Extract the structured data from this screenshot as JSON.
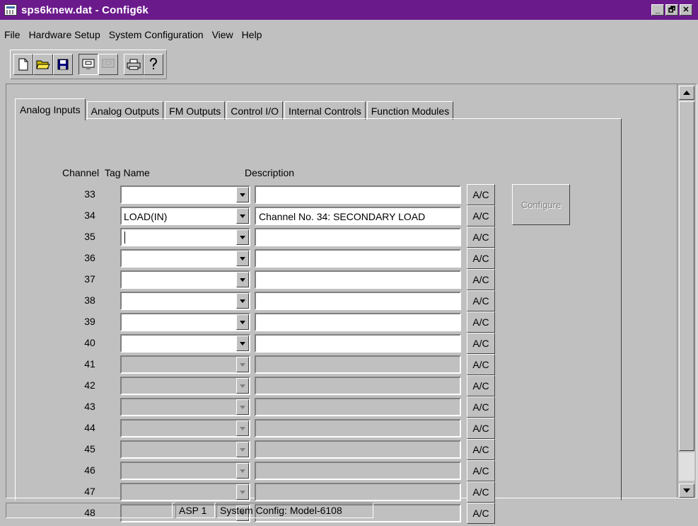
{
  "window": {
    "title": "sps6knew.dat - Config6k",
    "controls": [
      "_",
      "🗗",
      "✕"
    ]
  },
  "menu": [
    "File",
    "Hardware Setup",
    "System Configuration",
    "View",
    "Help"
  ],
  "toolbar": {
    "buttons": [
      "new-file-icon",
      "open-folder-icon",
      "save-disk-icon",
      "monitor-icon",
      "disabled-monitor-icon",
      "print-icon",
      "help-question-icon"
    ]
  },
  "tabs": [
    "Analog Inputs",
    "Analog Outputs",
    "FM Outputs",
    "Control I/O",
    "Internal Controls",
    "Function Modules"
  ],
  "active_tab": "Analog Inputs",
  "columns": {
    "channel": "Channel",
    "tag": "Tag Name",
    "description": "Description"
  },
  "rows": [
    {
      "channel": "33",
      "tag": "",
      "description": "",
      "ac": "A/C",
      "enabled": true
    },
    {
      "channel": "34",
      "tag": "LOAD(IN)",
      "description": "Channel No. 34: SECONDARY LOAD",
      "ac": "A/C",
      "enabled": true
    },
    {
      "channel": "35",
      "tag": "",
      "description": "",
      "ac": "A/C",
      "enabled": true
    },
    {
      "channel": "36",
      "tag": "",
      "description": "",
      "ac": "A/C",
      "enabled": true
    },
    {
      "channel": "37",
      "tag": "",
      "description": "",
      "ac": "A/C",
      "enabled": true
    },
    {
      "channel": "38",
      "tag": "",
      "description": "",
      "ac": "A/C",
      "enabled": true
    },
    {
      "channel": "39",
      "tag": "",
      "description": "",
      "ac": "A/C",
      "enabled": true
    },
    {
      "channel": "40",
      "tag": "",
      "description": "",
      "ac": "A/C",
      "enabled": true
    },
    {
      "channel": "41",
      "tag": "",
      "description": "",
      "ac": "A/C",
      "enabled": false
    },
    {
      "channel": "42",
      "tag": "",
      "description": "",
      "ac": "A/C",
      "enabled": false
    },
    {
      "channel": "43",
      "tag": "",
      "description": "",
      "ac": "A/C",
      "enabled": false
    },
    {
      "channel": "44",
      "tag": "",
      "description": "",
      "ac": "A/C",
      "enabled": false
    },
    {
      "channel": "45",
      "tag": "",
      "description": "",
      "ac": "A/C",
      "enabled": false
    },
    {
      "channel": "46",
      "tag": "",
      "description": "",
      "ac": "A/C",
      "enabled": false
    },
    {
      "channel": "47",
      "tag": "",
      "description": "",
      "ac": "A/C",
      "enabled": false
    },
    {
      "channel": "48",
      "tag": "",
      "description": "",
      "ac": "A/C",
      "enabled": false
    }
  ],
  "configure_button": "Configure",
  "status": {
    "left": "",
    "asp": "ASP 1",
    "config": "System Config: Model-6108"
  },
  "colors": {
    "titlebar": "#6b1a8c",
    "face": "#c0c0c0",
    "disabled_text": "#808080"
  }
}
